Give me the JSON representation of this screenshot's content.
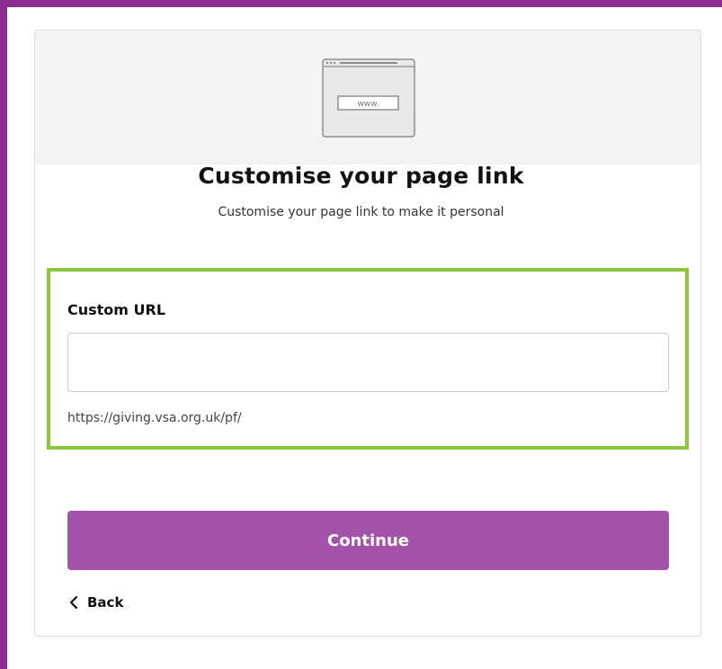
{
  "illustration": {
    "url_text": "www."
  },
  "header": {
    "title": "Customise your page link",
    "subtitle": "Customise your page link to make it personal"
  },
  "form": {
    "custom_url_label": "Custom URL",
    "custom_url_value": "",
    "custom_url_placeholder": "",
    "url_prefix": "https://giving.vsa.org.uk/pf/"
  },
  "actions": {
    "continue_label": "Continue",
    "back_label": "Back"
  },
  "colors": {
    "frame": "#8d2b8f",
    "primary_button": "#a454a8",
    "highlight": "#8cc83f"
  },
  "icons": {
    "back": "chevron-left-icon",
    "illustration": "browser-window-icon"
  }
}
